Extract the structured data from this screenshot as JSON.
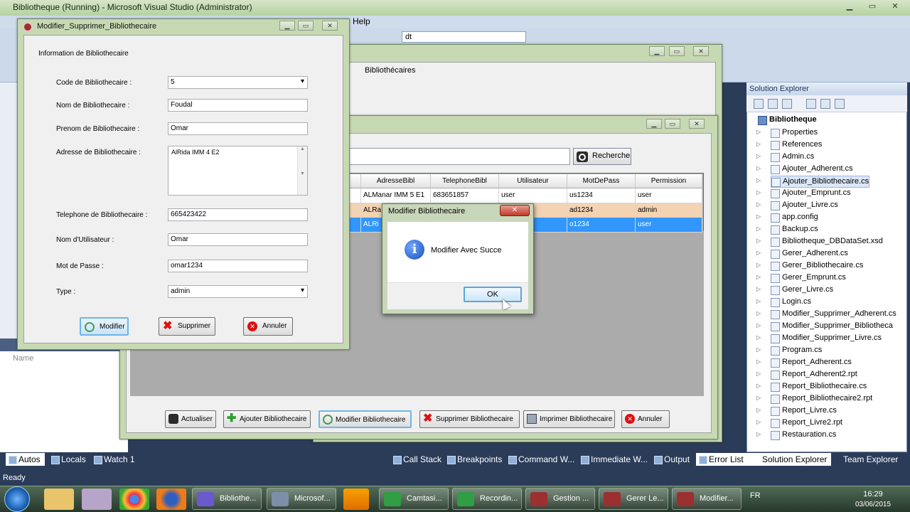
{
  "vs": {
    "title": "Bibliotheque (Running) - Microsoft Visual Studio (Administrator)",
    "menu_help": "Help",
    "config_combo": "dt",
    "autos_column": "Name",
    "status": "Ready",
    "bottom_tabs": [
      "Autos",
      "Locals",
      "Watch 1",
      "Call Stack",
      "Breakpoints",
      "Command W...",
      "Immediate W...",
      "Output",
      "Error List"
    ],
    "panel_tabs": [
      "Solution Explorer",
      "Team Explorer"
    ]
  },
  "solution_explorer": {
    "title": "Solution Explorer",
    "project": "Bibliotheque",
    "items": [
      "Properties",
      "References",
      "Admin.cs",
      "Ajouter_Adherent.cs",
      "Ajouter_Bibliothecaire.cs",
      "Ajouter_Emprunt.cs",
      "Ajouter_Livre.cs",
      "app.config",
      "Backup.cs",
      "Bibliotheque_DBDataSet.xsd",
      "Gerer_Adherent.cs",
      "Gerer_Bibliothecaire.cs",
      "Gerer_Emprunt.cs",
      "Gerer_Livre.cs",
      "Login.cs",
      "Modifier_Supprimer_Adherent.cs",
      "Modifier_Supprimer_Bibliotheca",
      "Modifier_Supprimer_Livre.cs",
      "Program.cs",
      "Report_Adherent.cs",
      "Report_Adherent2.rpt",
      "Report_Bibliothecaire.cs",
      "Report_Bibliothecaire2.rpt",
      "Report_Livre.cs",
      "Report_Livre2.rpt",
      "Restauration.cs"
    ]
  },
  "back_form": {
    "menu_item": "Bibliothécaires",
    "search_button": "Recherche",
    "grid": {
      "columns": [
        "AdresseBibl",
        "TelephoneBibl",
        "Utilisateur",
        "MotDePass",
        "Permission"
      ],
      "rows": [
        [
          "ALManar IMM 5 E1",
          "683651857",
          "user",
          "us1234",
          "user"
        ],
        [
          "ALRa",
          "",
          "",
          "ad1234",
          "admin"
        ],
        [
          "ALRi",
          "",
          "",
          "o1234",
          "user"
        ]
      ]
    },
    "buttons": [
      "Actualiser",
      "Ajouter Bibliothecaire",
      "Modifier Bibliothecaire",
      "Supprimer Bibliothecaire",
      "Imprimer Bibliothecaire",
      "Annuler"
    ]
  },
  "modify_form": {
    "title": "Modifier_Supprimer_Bibliothecaire",
    "group_title": "Information de Bibliothecaire",
    "labels": {
      "code": "Code de Bibliothecaire :",
      "nom": "Nom de Bibliothecaire :",
      "prenom": "Prenom de Bibliothecaire :",
      "adresse": "Adresse de Bibliothecaire :",
      "telephone": "Telephone de Bibliothecaire :",
      "utilisateur": "Nom d'Utilisateur :",
      "password": "Mot de Passe :",
      "type": "Type :"
    },
    "values": {
      "code": "5",
      "nom": "Foudal",
      "prenom": "Omar",
      "adresse": "AlRida IMM 4 E2",
      "telephone": "665423422",
      "utilisateur": "Omar",
      "password": "omar1234",
      "type": "admin"
    },
    "buttons": {
      "modifier": "Modifier",
      "supprimer": "Supprimer",
      "annuler": "Annuler"
    }
  },
  "message_box": {
    "title": "Modifier Bibliothecaire",
    "message": "Modifier Avec Succe",
    "ok": "OK"
  },
  "taskbar": {
    "tasks": [
      "Bibliothe...",
      "Microsof...",
      "Camtasi...",
      "Recordin...",
      "Gestion ...",
      "Gerer Le...",
      "Modifier..."
    ],
    "language": "FR",
    "time": "16:29",
    "date": "03/06/2015"
  },
  "colors": {
    "selected_row": "#3297fd",
    "highlight_row": "#f4d3b2",
    "vs_dark": "#2b3c59"
  }
}
